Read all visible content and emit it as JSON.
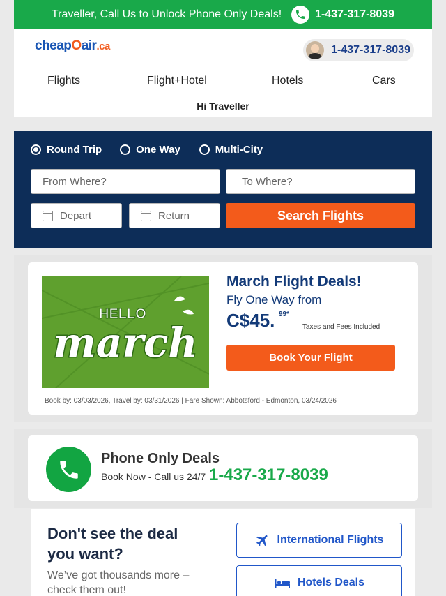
{
  "banner": {
    "message": "Traveller, Call Us to Unlock Phone Only Deals!",
    "phone": "1-437-317-8039"
  },
  "header": {
    "logo": {
      "part1": "cheap",
      "part2": "O",
      "part3": "air",
      "suffix": ".ca"
    },
    "phone": "1-437-317-8039",
    "nav": [
      "Flights",
      "Flight+Hotel",
      "Hotels",
      "Cars"
    ],
    "greeting": "Hi Traveller"
  },
  "search": {
    "trip_types": [
      {
        "label": "Round Trip",
        "selected": true
      },
      {
        "label": "One Way",
        "selected": false
      },
      {
        "label": "Multi-City",
        "selected": false
      }
    ],
    "from_placeholder": "From Where?",
    "to_placeholder": "To Where?",
    "depart_placeholder": "Depart",
    "return_placeholder": "Return",
    "button": "Search Flights"
  },
  "deal": {
    "image_text": {
      "hello": "HELLO",
      "march": "march"
    },
    "title": "March Flight Deals!",
    "subtitle": "Fly One Way from",
    "price": "C$45.",
    "cents": "99*",
    "taxes": "Taxes and Fees Included",
    "button": "Book Your Flight",
    "fine_print": "Book by: 03/03/2026, Travel by: 03/31/2026  | Fare Shown: Abbotsford - Edmonton, 03/24/2026"
  },
  "phone_deals": {
    "title": "Phone Only Deals",
    "subtitle": "Book Now - Call us 24/7",
    "phone": "1-437-317-8039"
  },
  "bottom": {
    "title": "Don't see the deal you want?",
    "subtitle": "We’ve got thousands more – check them out!",
    "links": [
      "International Flights",
      "Hotels Deals"
    ]
  },
  "colors": {
    "banner_green": "#19a94a",
    "search_navy": "#0d2d58",
    "accent_orange": "#f35b1b",
    "deal_blue": "#133a78",
    "link_blue": "#2157c9"
  }
}
